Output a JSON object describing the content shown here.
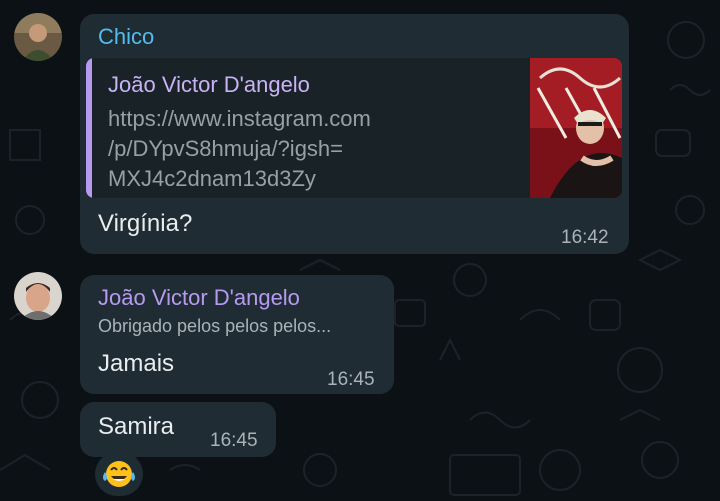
{
  "colors": {
    "wallpaper": "#0b1115",
    "bubble": "#1f2c33",
    "sender_chico": "#53bdeb",
    "sender_joao": "#b79af0",
    "link_accent": "#b79af0",
    "text": "#e9edef",
    "time": "#a9b3b9"
  },
  "messages": [
    {
      "sender": "Chico",
      "link_preview": {
        "title": "João Victor D'angelo",
        "url_lines": [
          "https://www.instagram.com",
          "/p/DYpvS8hmuja/?igsh=",
          "MXJ4c2dnam13d3Zy"
        ],
        "thumbnail_icon": "album-cover-image"
      },
      "text": "Virgínia?",
      "time": "16:42"
    },
    {
      "sender": "João Victor D'angelo",
      "reply_to": "Obrigado pelos pelos pelos...",
      "text": "Jamais",
      "time": "16:45"
    },
    {
      "text": "Samira",
      "time": "16:45"
    }
  ],
  "reaction_chip": {
    "emoji": "😂",
    "icon": "tears-of-joy-emoji-icon"
  }
}
